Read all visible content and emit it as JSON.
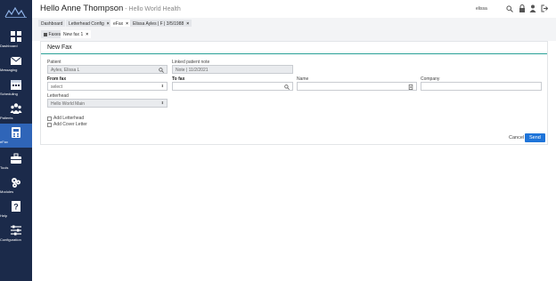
{
  "header": {
    "greeting": "Hello Anne Thompson",
    "org": " - Hello World Health",
    "search_value": "elissa"
  },
  "tabs": [
    {
      "label": "Dashboard",
      "closable": false
    },
    {
      "label": "Letterhead Config",
      "closable": true
    },
    {
      "label": "eFax",
      "closable": true
    },
    {
      "label": "Elissa Ayles | F | 3/5/1988",
      "closable": true
    }
  ],
  "subnav": {
    "faxes": "Faxes",
    "new_fax": "New fax 1"
  },
  "sidebar": {
    "items": [
      {
        "label": "Dashboard",
        "icon": "dashboard-icon"
      },
      {
        "label": "Messaging",
        "icon": "envelope-icon"
      },
      {
        "label": "Scheduling",
        "icon": "calendar-icon"
      },
      {
        "label": "Patients",
        "icon": "people-icon"
      },
      {
        "label": "eFax",
        "icon": "fax-icon"
      },
      {
        "label": "Tools",
        "icon": "toolbox-icon"
      },
      {
        "label": "Modules",
        "icon": "modules-icon"
      },
      {
        "label": "Help",
        "icon": "help-icon"
      },
      {
        "label": "Configuration",
        "icon": "sliders-icon"
      }
    ]
  },
  "form": {
    "title": "New Fax",
    "patient_label": "Patient",
    "patient_value": "Ayles, Elissa L",
    "linked_note_label": "Linked patient note",
    "linked_note_value": "Note | 11/2/2021",
    "from_fax_label": "From fax",
    "from_fax_value": "select",
    "to_fax_label": "To fax",
    "name_label": "Name",
    "company_label": "Company",
    "letterhead_label": "Letterhead",
    "letterhead_value": "Hello World Main",
    "add_letterhead": "Add Letterhead",
    "add_cover_letter": "Add Cover Letter",
    "cancel": "Cancel",
    "send": "Send"
  },
  "colors": {
    "sidebar": "#1b2a4a",
    "active": "#2f65b8",
    "accent_line": "#2aa198",
    "send": "#1e74d9"
  }
}
